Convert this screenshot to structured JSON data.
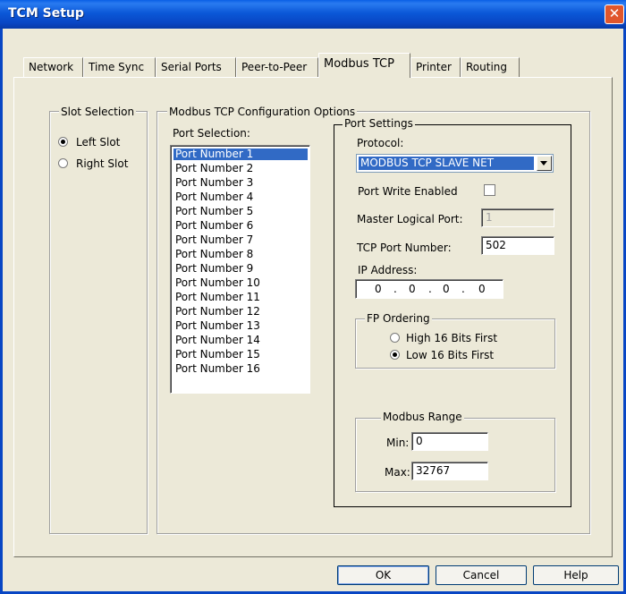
{
  "window": {
    "title": "TCM Setup"
  },
  "tabs": [
    "Network",
    "Time Sync",
    "Serial Ports",
    "Peer-to-Peer",
    "Modbus TCP",
    "Printer",
    "Routing"
  ],
  "active_tab": "Modbus TCP",
  "slot_selection": {
    "title": "Slot Selection",
    "options": [
      "Left Slot",
      "Right Slot"
    ],
    "selected": "Left Slot"
  },
  "modbus_config": {
    "title": "Modbus TCP Configuration Options",
    "port_selection_label": "Port Selection:",
    "ports": [
      "Port Number 1",
      "Port Number 2",
      "Port Number 3",
      "Port Number 4",
      "Port Number 5",
      "Port Number 6",
      "Port Number 7",
      "Port Number 8",
      "Port Number 9",
      "Port Number 10",
      "Port Number 11",
      "Port Number 12",
      "Port Number 13",
      "Port Number 14",
      "Port Number 15",
      "Port Number 16"
    ],
    "selected_port": "Port Number 1"
  },
  "port_settings": {
    "title": "Port Settings",
    "protocol_label": "Protocol:",
    "protocol_value": "MODBUS TCP SLAVE NET",
    "port_write_label": "Port Write Enabled",
    "port_write_checked": false,
    "master_logical_port_label": "Master Logical Port:",
    "master_logical_port_value": "1",
    "tcp_port_label": "TCP Port Number:",
    "tcp_port_value": "502",
    "ip_label": "IP Address:",
    "ip_octets": [
      "0",
      "0",
      "0",
      "0"
    ],
    "fp_ordering": {
      "title": "FP Ordering",
      "options": [
        "High 16 Bits First",
        "Low 16 Bits First"
      ],
      "selected": "Low 16 Bits First"
    },
    "modbus_range": {
      "title": "Modbus Range",
      "min_label": "Min:",
      "min_value": "0",
      "max_label": "Max:",
      "max_value": "32767"
    }
  },
  "buttons": {
    "ok": "OK",
    "cancel": "Cancel",
    "help": "Help"
  },
  "colors": {
    "titlebar": "#0846c4",
    "selection": "#316ac5",
    "face": "#ece9d8"
  }
}
